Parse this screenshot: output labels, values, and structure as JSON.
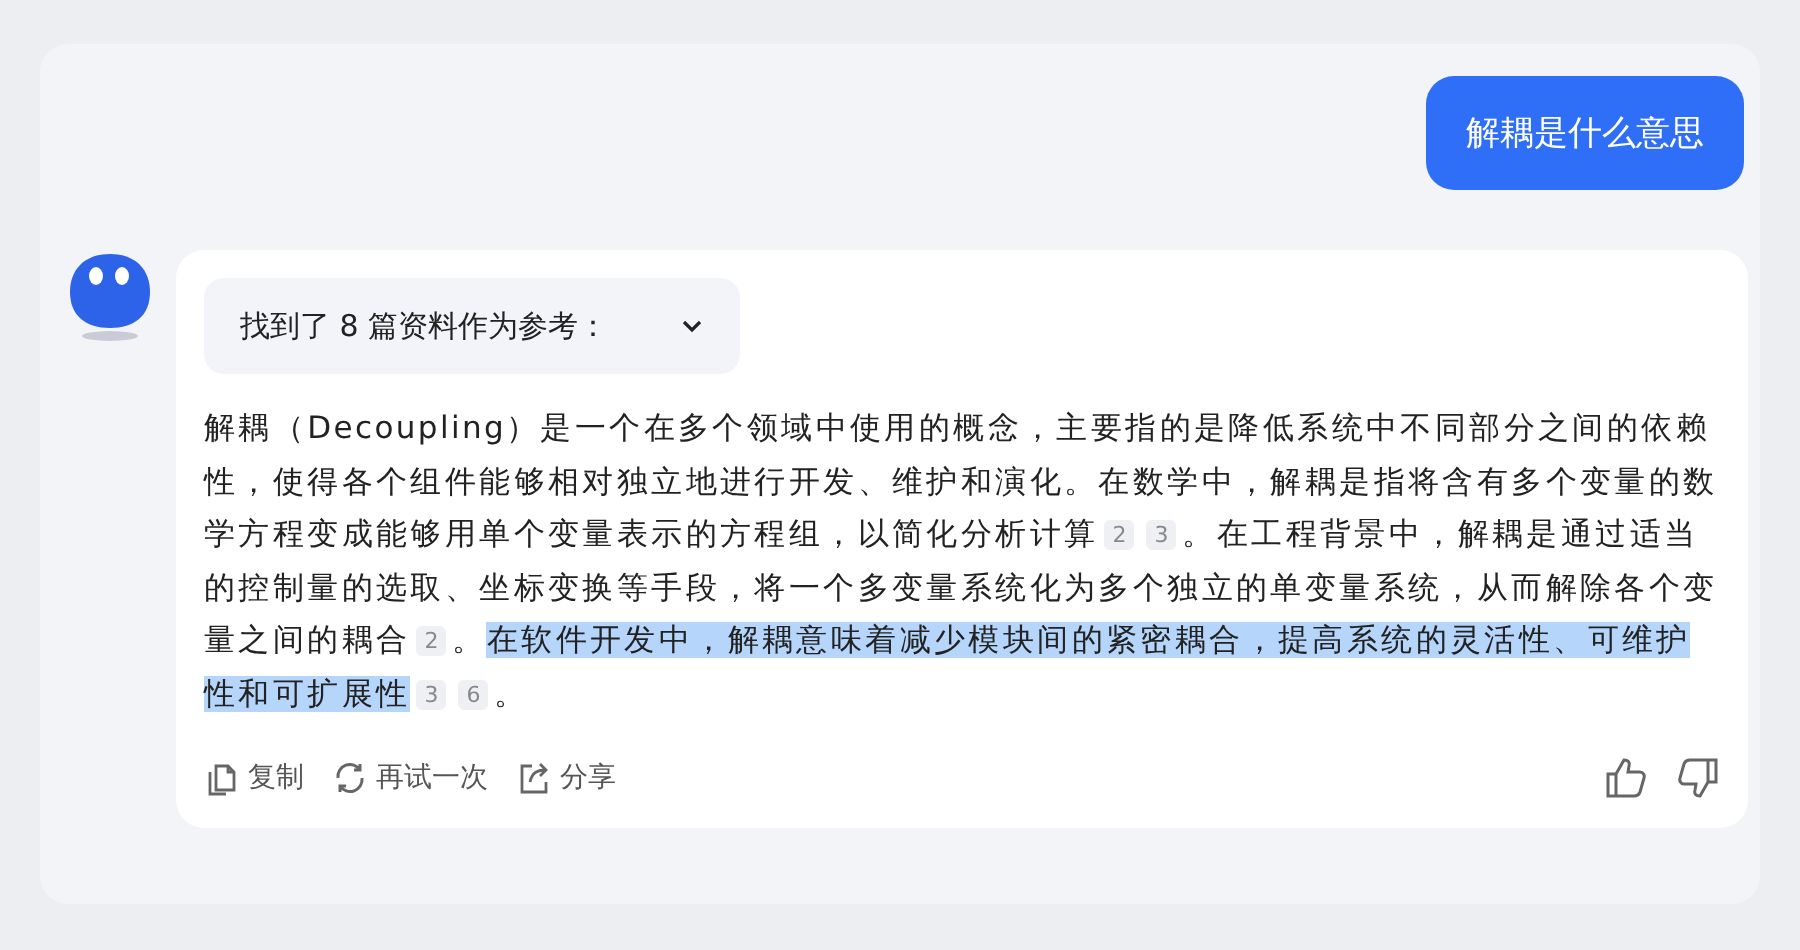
{
  "user_message": {
    "text": "解耦是什么意思"
  },
  "answer": {
    "references": {
      "label": "找到了 8 篇资料作为参考：",
      "expanded": false
    },
    "segments": [
      {
        "kind": "text",
        "text": "解耦（Decoupling）是一个在多个领域中使用的概念，主要指的是降低系统中不同部分之间的依赖性，使得各个组件能够相对独立地进行开发、维护和演化。在数学中，解耦是指将含有多个变量的数学方程变成能够用单个变量表示的方程组，以简化分析计算"
      },
      {
        "kind": "cite",
        "text": "2"
      },
      {
        "kind": "cite",
        "text": "3"
      },
      {
        "kind": "text",
        "text": "。在工程背景中，解耦是通过适当的控制量的选取、坐标变换等手段，将一个多变量系统化为多个独立的单变量系统，从而解除各个变量之间的耦合"
      },
      {
        "kind": "cite",
        "text": "2"
      },
      {
        "kind": "text",
        "text": "。"
      },
      {
        "kind": "highlight",
        "text": "在软件开发中，解耦意味着减少模块间的紧密耦合，提高系统的灵活性、可维护性和可扩展性"
      },
      {
        "kind": "cite",
        "text": "3"
      },
      {
        "kind": "cite",
        "text": "6"
      },
      {
        "kind": "text",
        "text": "。"
      }
    ],
    "actions": [
      {
        "kind": "copy",
        "label": "复制"
      },
      {
        "kind": "retry",
        "label": "再试一次"
      },
      {
        "kind": "share",
        "label": "分享"
      }
    ],
    "feedback": [
      {
        "kind": "like"
      },
      {
        "kind": "dislike"
      }
    ]
  }
}
